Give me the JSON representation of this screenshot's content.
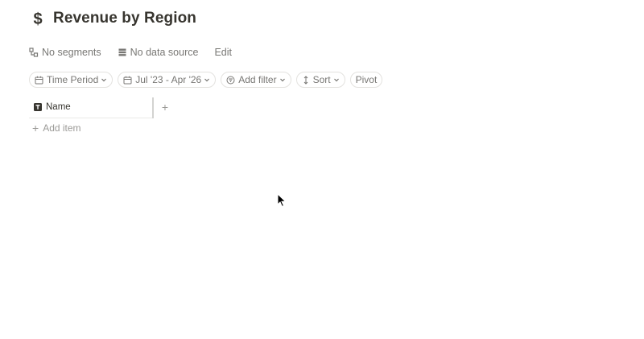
{
  "page": {
    "title": "Revenue by Region",
    "title_icon": "dollar-icon"
  },
  "meta": {
    "segments_label": "No segments",
    "data_source_label": "No data source",
    "edit_label": "Edit"
  },
  "filters": {
    "time_period_label": "Time Period",
    "date_range_label": "Jul '23 - Apr '26",
    "add_filter_label": "Add filter",
    "sort_label": "Sort",
    "pivot_label": "Pivot"
  },
  "table": {
    "name_column_label": "Name",
    "add_column_label": "+",
    "add_item_label": "Add item"
  },
  "colors": {
    "text": "#37352f",
    "muted": "#787774",
    "border": "#e3e2df"
  }
}
